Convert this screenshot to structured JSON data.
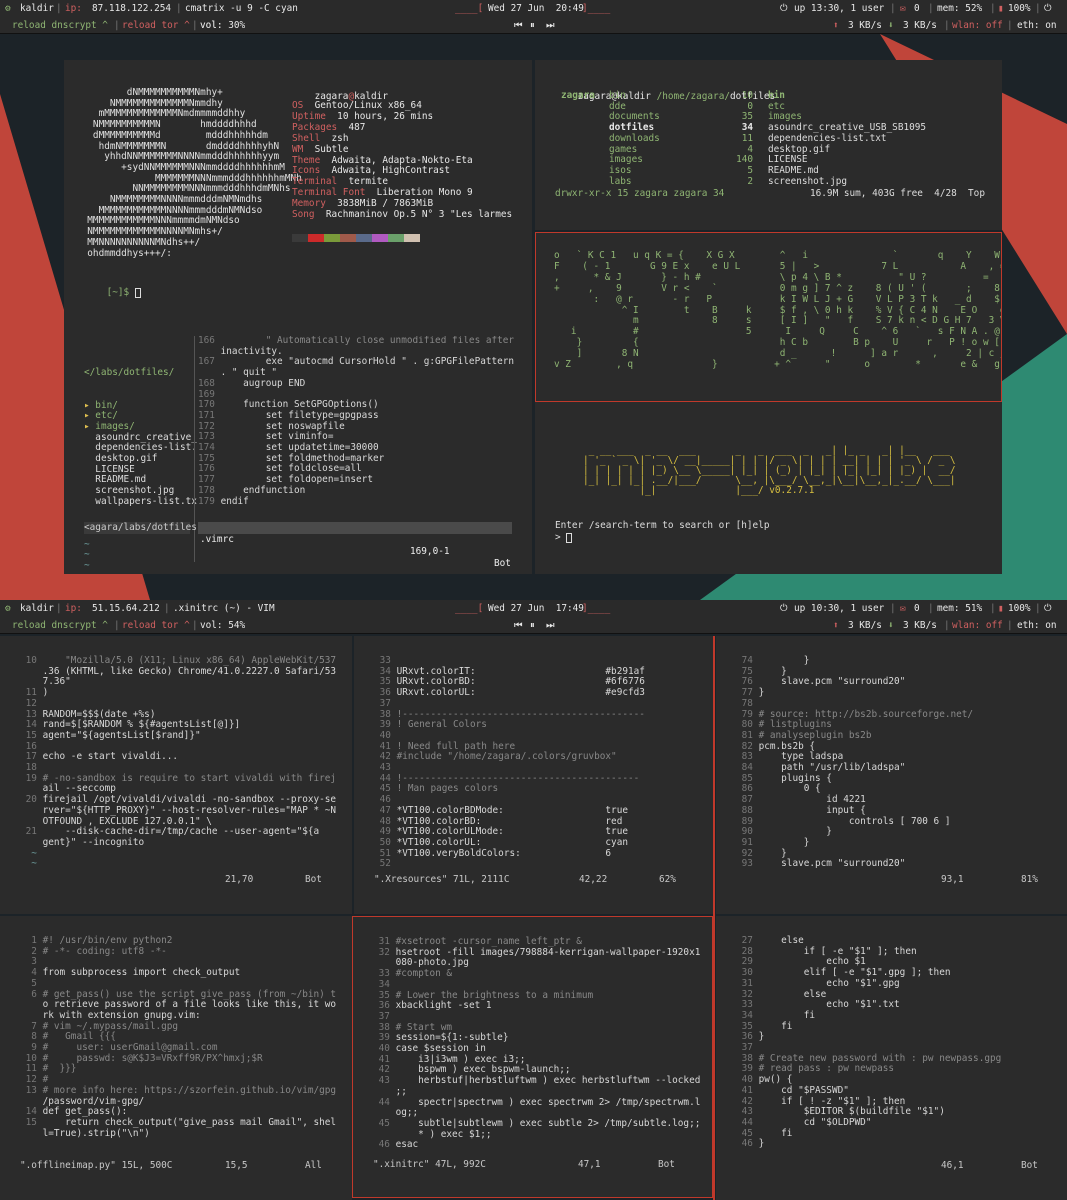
{
  "screen1": {
    "bar": {
      "host": "kaldir",
      "ip_label": "ip:",
      "ip": "87.118.122.254",
      "cmd": "cmatrix -u 9 -C cyan",
      "clock": "Wed 27 Jun  20:49",
      "uptime": "up 13:30, 1 user",
      "mail": "0",
      "mem": "mem: 52%",
      "bat": "100%",
      "reload_dns": "reload dnscrypt ^",
      "reload_tor": "reload tor ^",
      "vol": "vol: 30%",
      "down": "3 KB/s",
      "up": "3 KB/s",
      "wlan": "wlan: off",
      "eth": "eth: on"
    },
    "screenfetch": {
      "user": "zagara",
      "host": "kaldir",
      "ascii": [
        "         dNMMMMMMMMMMNmhy+",
        "      NMMMMMMMMMMMMMNmmdhy",
        "    mMMMMMMMMMMMMMNmdmmmmddhhy",
        "   NMMMMMMMMMMN       hmddddhhhd",
        "   dMMMMMMMMMMd        mdddhhhhhdm",
        "    hdmNMMMMMMMN       dmddddhhhhyhN",
        "     yhhdNNMMMMMMMNNNNmmdddhhhhhhyym",
        "        +sydNNMMMMMMNNNmmddddhhhhhhmM",
        "              MMMMMMMNNNmmmdddhhhhhhmMNh",
        "          NNMMMMMMMMNNNmmmdddhhhdmMNhs",
        "      NMMMMMMMMNNNNmmmdddmNMNmdhs",
        "    MMMMMMMMMMMMNNNNmmmdddmNMNdso",
        "  MMMMMMMMMMMMNNNmmmmdmNMNdso",
        "  NMMMMMMMMMMMMNNNNMNmhs+/",
        "  MMNNNNNNNNNNMNdhs++/",
        "  ohdmmddhys+++/:"
      ],
      "info": [
        [
          "OS",
          "Gentoo/Linux x86_64"
        ],
        [
          "Uptime",
          "10 hours, 26 mins"
        ],
        [
          "Packages",
          "487"
        ],
        [
          "Shell",
          "zsh"
        ],
        [
          "WM",
          "Subtle"
        ],
        [
          "Theme",
          "Adwaita, Adapta-Nokto-Eta"
        ],
        [
          "Icons",
          "Adwaita, HighContrast"
        ],
        [
          "Terminal",
          "termite"
        ],
        [
          "Terminal Font",
          "Liberation Mono 9"
        ],
        [
          "Memory",
          "3838MiB / 7863MiB"
        ],
        [
          "Song",
          "Rachmaninov Op.5 N° 3 \"Les larmes"
        ]
      ],
      "swatches": [
        "#3a3a3a",
        "#cc2a2a",
        "#7a9a3a",
        "#a05a4a",
        "#5a6a8a",
        "#b05ac0",
        "#6aa06a",
        "#d0c0b0"
      ],
      "prompt": "[~]$"
    },
    "ranger": {
      "title_user": "zagara@kaldir",
      "title_path": "/home/zagara/",
      "title_dir": "dotfiles",
      "col1": [
        "zagara"
      ],
      "col2": [
        [
          "bin",
          "10"
        ],
        [
          "dde",
          "0"
        ],
        [
          "documents",
          "35"
        ],
        [
          "dotfiles",
          "34"
        ],
        [
          "downloads",
          "11"
        ],
        [
          "games",
          "4"
        ],
        [
          "images",
          "140"
        ],
        [
          "isos",
          "5"
        ],
        [
          "labs",
          "2"
        ]
      ],
      "col3": [
        "bin",
        "etc",
        "images",
        "asoundrc_creative_USB_SB1095",
        "dependencies-list.txt",
        "desktop.gif",
        "LICENSE",
        "README.md",
        "screenshot.jpg"
      ],
      "status_left": "drwxr-xr-x 15 zagara zagara 34",
      "status_right": "16.9M sum, 403G free  4/28  Top"
    },
    "matrix": [
      "o   ` K C 1   u q K = {    X G X        ^   i               `       q    Y    W i )     `",
      "F    ( - 1       G 9 E x    e U L       5 |   >           7 L           A    , = >    ]",
      ",      * & J       } - h #              \\ p 4 \\ B *          \" U ?          =   \\ P !     Z",
      "+     ,    9       V r <    `           0 m g ] 7 ^ z    8 ( U ' (       ;    8    B |    +",
      "       :   @ r       - r   P            k I W L J + G    V L P 3 T k   _ d    $ }    o",
      "            ^ I        t    B     k     $ f , \\ 0 h k    % V { C 4 N    E O    d b    L",
      "              m             8     s     [ I ]   \"   f    S 7 k n < D G H 7   3 V    ]",
      "   i          #                   5      I     Q     C    ^ 6   `   s F N A . @",
      "    }         {                         h C b        B p    U     r   P ! o w [       |",
      "    ]       8 N                         d _      !      ] a r      ,     2 | c j #      p",
      "v Z        , q              }          + ^      \"      o        *       e &   g 0    | p"
    ],
    "mpsyt": {
      "banner": [
        " _ __ ___  _ __  ___       _   _  ___  _   _| |_ _   _| |__   ___",
        "| '_ ` _ \\| '_ \\/ __|_____| | | |/ _ \\| | | | __| | | | '_ \\ / _ \\",
        "| | | | | | |_) \\__ \\_____| |_| | (_) | |_| | |_| |_| | |_) |  __/",
        "|_| |_| |_| .__/|___/      \\__, |\\___/ \\__,_|\\__|\\__,_|_.__/ \\___|",
        "          |_|              |___/ v0.2.7.1"
      ],
      "help": "Enter /search-term to search or [h]elp",
      "prompt": ">"
    },
    "vim": {
      "tree_path": "</labs/dotfiles/",
      "tree": [
        "bin/",
        "etc/",
        "images/",
        "asoundrc_creative_",
        "dependencies-list.",
        "desktop.gif",
        "LICENSE",
        "README.md",
        "screenshot.jpg",
        "wallpapers-list.tx"
      ],
      "lines": [
        [
          "166",
          "        \" Automatically close unmodified files after"
        ],
        [
          "",
          "inactivity."
        ],
        [
          "167",
          "        exe \"autocmd CursorHold \" . g:GPGFilePattern"
        ],
        [
          "",
          ". \" quit \""
        ],
        [
          "168",
          "    augroup END"
        ],
        [
          "169",
          ""
        ],
        [
          "170",
          "    function SetGPGOptions()"
        ],
        [
          "171",
          "        set filetype=gpgpass"
        ],
        [
          "172",
          "        set noswapfile"
        ],
        [
          "173",
          "        set viminfo="
        ],
        [
          "174",
          "        set updatetime=30000"
        ],
        [
          "175",
          "        set foldmethod=marker"
        ],
        [
          "176",
          "        set foldclose=all"
        ],
        [
          "177",
          "        set foldopen=insert"
        ],
        [
          "178",
          "    endfunction"
        ],
        [
          "179",
          "endif"
        ]
      ],
      "status_left": "<agara/labs/dotfiles",
      "status_file": ".vimrc",
      "status_pos": "169,0-1",
      "status_scroll": "Bot"
    }
  },
  "screen2": {
    "bar": {
      "host": "kaldir",
      "ip_label": "ip:",
      "ip": "51.15.64.212",
      "cmd": ".xinitrc (~) - VIM",
      "clock": "Wed 27 Jun  17:49",
      "uptime": "up 10:30, 1 user",
      "mail": "0",
      "mem": "mem: 51%",
      "bat": "100%",
      "reload_dns": "reload dnscrypt ^",
      "reload_tor": "reload tor ^",
      "vol": "vol: 54%",
      "down": "3 KB/s",
      "up": "3 KB/s",
      "wlan": "wlan: off",
      "eth": "eth: on"
    },
    "p1": {
      "lines": [
        [
          "10",
          "    \"Mozilla/5.0 (X11; Linux x86_64) AppleWebKit/537"
        ],
        [
          "",
          ".36 (KHTML, like Gecko) Chrome/41.0.2227.0 Safari/53"
        ],
        [
          "",
          "7.36\""
        ],
        [
          "11",
          ")"
        ],
        [
          "12",
          ""
        ],
        [
          "13",
          "RANDOM=$$$(date +%s)"
        ],
        [
          "14",
          "rand=$[$RANDOM % ${#agentsList[@]}]"
        ],
        [
          "15",
          "agent=\"${agentsList[$rand]}\""
        ],
        [
          "16",
          ""
        ],
        [
          "17",
          "echo -e start vivaldi..."
        ],
        [
          "18",
          ""
        ],
        [
          "19",
          "# -no-sandbox is require to start vivaldi with firej"
        ],
        [
          "",
          "ail --seccomp"
        ],
        [
          "20",
          "firejail /opt/vivaldi/vivaldi -no-sandbox --proxy-se"
        ],
        [
          "",
          "rver=\"${HTTP_PROXY}\" --host-resolver-rules=\"MAP * ~N"
        ],
        [
          "",
          "OTFOUND , EXCLUDE 127.0.0.1\" \\"
        ],
        [
          "21",
          "    --disk-cache-dir=/tmp/cache --user-agent=\"${a"
        ],
        [
          "",
          "gent}\" --incognito"
        ],
        [
          "~",
          ""
        ],
        [
          "~",
          ""
        ]
      ],
      "status_pos": "21,70",
      "status_scroll": "Bot"
    },
    "p2": {
      "lines": [
        [
          "33",
          ""
        ],
        [
          "34",
          "URxvt.colorIT:                       #b291af"
        ],
        [
          "35",
          "URxvt.colorBD:                       #6f6776"
        ],
        [
          "36",
          "URxvt.colorUL:                       #e9cfd3"
        ],
        [
          "37",
          ""
        ],
        [
          "38",
          "!-------------------------------------------"
        ],
        [
          "39",
          "! General Colors"
        ],
        [
          "40",
          ""
        ],
        [
          "41",
          "! Need full path here"
        ],
        [
          "42",
          "#include \"/home/zagara/.colors/gruvbox\""
        ],
        [
          "43",
          ""
        ],
        [
          "44",
          "!------------------------------------------"
        ],
        [
          "45",
          "! Man pages colors"
        ],
        [
          "46",
          ""
        ],
        [
          "47",
          "*VT100.colorBDMode:                  true"
        ],
        [
          "48",
          "*VT100.colorBD:                      red"
        ],
        [
          "49",
          "*VT100.colorULMode:                  true"
        ],
        [
          "50",
          "*VT100.colorUL:                      cyan"
        ],
        [
          "51",
          "*VT100.veryBoldColors:               6"
        ],
        [
          "52",
          ""
        ]
      ],
      "status_file": "\".Xresources\" 71L, 2111C",
      "status_pos": "42,22",
      "status_scroll": "62%"
    },
    "p3": {
      "lines": [
        [
          "74",
          "        }"
        ],
        [
          "75",
          "    }"
        ],
        [
          "76",
          "    slave.pcm \"surround20\""
        ],
        [
          "77",
          "}"
        ],
        [
          "78",
          ""
        ],
        [
          "79",
          "# source: http://bs2b.sourceforge.net/"
        ],
        [
          "80",
          "# listplugins"
        ],
        [
          "81",
          "# analyseplugin bs2b"
        ],
        [
          "82",
          "pcm.bs2b {"
        ],
        [
          "83",
          "    type ladspa"
        ],
        [
          "84",
          "    path \"/usr/lib/ladspa\""
        ],
        [
          "85",
          "    plugins {"
        ],
        [
          "86",
          "        0 {"
        ],
        [
          "87",
          "            id 4221"
        ],
        [
          "88",
          "            input {"
        ],
        [
          "89",
          "                controls [ 700 6 ]"
        ],
        [
          "90",
          "            }"
        ],
        [
          "91",
          "        }"
        ],
        [
          "92",
          "    }"
        ],
        [
          "93",
          "    slave.pcm \"surround20\""
        ]
      ],
      "status_pos": "93,1",
      "status_scroll": "81%"
    },
    "p4": {
      "lines": [
        [
          "1",
          "#! /usr/bin/env python2"
        ],
        [
          "2",
          "# -*- coding: utf8 -*-"
        ],
        [
          "3",
          ""
        ],
        [
          "4",
          "from subprocess import check_output"
        ],
        [
          "5",
          ""
        ],
        [
          "6",
          "# get_pass() use the script give_pass (from ~/bin) t"
        ],
        [
          "",
          "o retrieve password of a file looks like this, it wo"
        ],
        [
          "",
          "rk with extension gnupg.vim:"
        ],
        [
          "7",
          "# vim ~/.mypass/mail.gpg"
        ],
        [
          "8",
          "#   Gmail {{{"
        ],
        [
          "9",
          "#     user: userGmail@gmail.com"
        ],
        [
          "10",
          "#     passwd: s@K$J3=VRxff9R/PX^hmxj;$R"
        ],
        [
          "11",
          "#  }}}"
        ],
        [
          "12",
          "#"
        ],
        [
          "13",
          "# more info here: https://szorfein.github.io/vim/gpg"
        ],
        [
          "",
          "/password/vim-gpg/"
        ],
        [
          "14",
          "def get_pass():"
        ],
        [
          "15",
          "    return check_output(\"give_pass mail Gmail\", shel"
        ],
        [
          "",
          "l=True).strip(\"\\n\")"
        ]
      ],
      "status_file": "\".offlineimap.py\" 15L, 500C",
      "status_pos": "15,5",
      "status_scroll": "All"
    },
    "p5": {
      "lines": [
        [
          "31",
          "#xsetroot -cursor_name left_ptr &"
        ],
        [
          "32",
          "hsetroot -fill images/798884-kerrigan-wallpaper-1920x1"
        ],
        [
          "",
          "080-photo.jpg"
        ],
        [
          "33",
          "#compton &"
        ],
        [
          "34",
          ""
        ],
        [
          "35",
          "# Lower the brightness to a minimum"
        ],
        [
          "36",
          "xbacklight -set 1"
        ],
        [
          "37",
          ""
        ],
        [
          "38",
          "# Start wm"
        ],
        [
          "39",
          "session=${1:-subtle}"
        ],
        [
          "40",
          "case $session in"
        ],
        [
          "41",
          "    i3|i3wm ) exec i3;;"
        ],
        [
          "42",
          "    bspwm ) exec bspwm-launch;;"
        ],
        [
          "43",
          "    herbstuf|herbstluftwm ) exec herbstluftwm --locked"
        ],
        [
          "",
          ";;"
        ],
        [
          "44",
          "    spectr|spectrwm ) exec spectrwm 2> /tmp/spectrwm.l"
        ],
        [
          "",
          "og;;"
        ],
        [
          "45",
          "    subtle|subtlewm ) exec subtle 2> /tmp/subtle.log;;"
        ],
        [
          "",
          "    * ) exec $1;;"
        ],
        [
          "46",
          "esac"
        ]
      ],
      "status_file": "\".xinitrc\" 47L, 992C",
      "status_pos": "47,1",
      "status_scroll": "Bot"
    },
    "p6": {
      "lines": [
        [
          "27",
          "    else"
        ],
        [
          "28",
          "        if [ -e \"$1\" ]; then"
        ],
        [
          "29",
          "            echo $1"
        ],
        [
          "30",
          "        elif [ -e \"$1\".gpg ]; then"
        ],
        [
          "31",
          "            echo \"$1\".gpg"
        ],
        [
          "32",
          "        else"
        ],
        [
          "33",
          "            echo \"$1\".txt"
        ],
        [
          "34",
          "        fi"
        ],
        [
          "35",
          "    fi"
        ],
        [
          "36",
          "}"
        ],
        [
          "37",
          ""
        ],
        [
          "38",
          "# Create new password with : pw newpass.gpg"
        ],
        [
          "39",
          "# read pass : pw newpass"
        ],
        [
          "40",
          "pw() {"
        ],
        [
          "41",
          "    cd \"$PASSWD\""
        ],
        [
          "42",
          "    if [ ! -z \"$1\" ]; then"
        ],
        [
          "43",
          "        $EDITOR $(buildfile \"$1\")"
        ],
        [
          "44",
          "        cd \"$OLDPWD\""
        ],
        [
          "45",
          "    fi"
        ],
        [
          "46",
          "}"
        ]
      ],
      "status_pos": "46,1",
      "status_scroll": "Bot"
    }
  },
  "colors": {
    "green": "#8fb573",
    "red": "#d06060",
    "accent": "#c0392b",
    "teal": "#2e8a72",
    "bg": "#2b2b2b"
  }
}
